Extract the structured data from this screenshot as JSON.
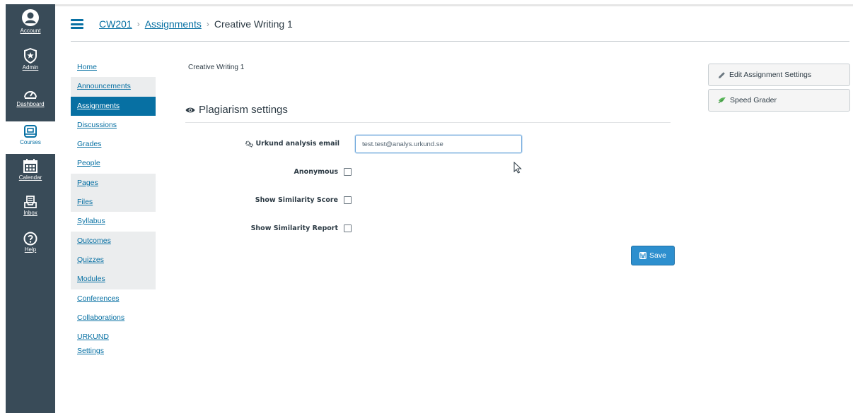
{
  "global_nav": {
    "items": [
      {
        "label": "Account",
        "icon": "account-icon"
      },
      {
        "label": "Admin",
        "icon": "admin-icon"
      },
      {
        "label": "Dashboard",
        "icon": "dashboard-icon"
      },
      {
        "label": "Courses",
        "icon": "courses-icon",
        "active": true
      },
      {
        "label": "Calendar",
        "icon": "calendar-icon"
      },
      {
        "label": "Inbox",
        "icon": "inbox-icon"
      },
      {
        "label": "Help",
        "icon": "help-icon"
      }
    ]
  },
  "breadcrumb": {
    "course": "CW201",
    "section": "Assignments",
    "current": "Creative Writing 1",
    "separator": "›"
  },
  "course_nav": {
    "items": [
      {
        "label": "Home"
      },
      {
        "label": "Announcements"
      },
      {
        "label": "Assignments"
      },
      {
        "label": "Discussions"
      },
      {
        "label": "Grades"
      },
      {
        "label": "People"
      },
      {
        "label": "Pages"
      },
      {
        "label": "Files"
      },
      {
        "label": "Syllabus"
      },
      {
        "label": "Outcomes"
      },
      {
        "label": "Quizzes"
      },
      {
        "label": "Modules"
      },
      {
        "label": "Conferences"
      },
      {
        "label": "Collaborations"
      },
      {
        "label": "URKUND"
      },
      {
        "label": "Settings"
      }
    ]
  },
  "main": {
    "assignment_title": "Creative Writing 1",
    "section_title": "Plagiarism settings",
    "email_label": "Urkund analysis email",
    "email_value": "test.test@analys.urkund.se",
    "anonymous_label": "Anonymous",
    "similarity_score_label": "Show Similarity Score",
    "similarity_report_label": "Show Similarity Report",
    "save_label": "Save"
  },
  "sidebar_actions": {
    "edit_label": "Edit Assignment Settings",
    "speed_grader_label": "Speed Grader"
  },
  "colors": {
    "global_nav_bg": "#394b58",
    "link": "#0770a3",
    "primary_button": "#2d8fce",
    "speed_grader_icon": "#5cb85c"
  }
}
